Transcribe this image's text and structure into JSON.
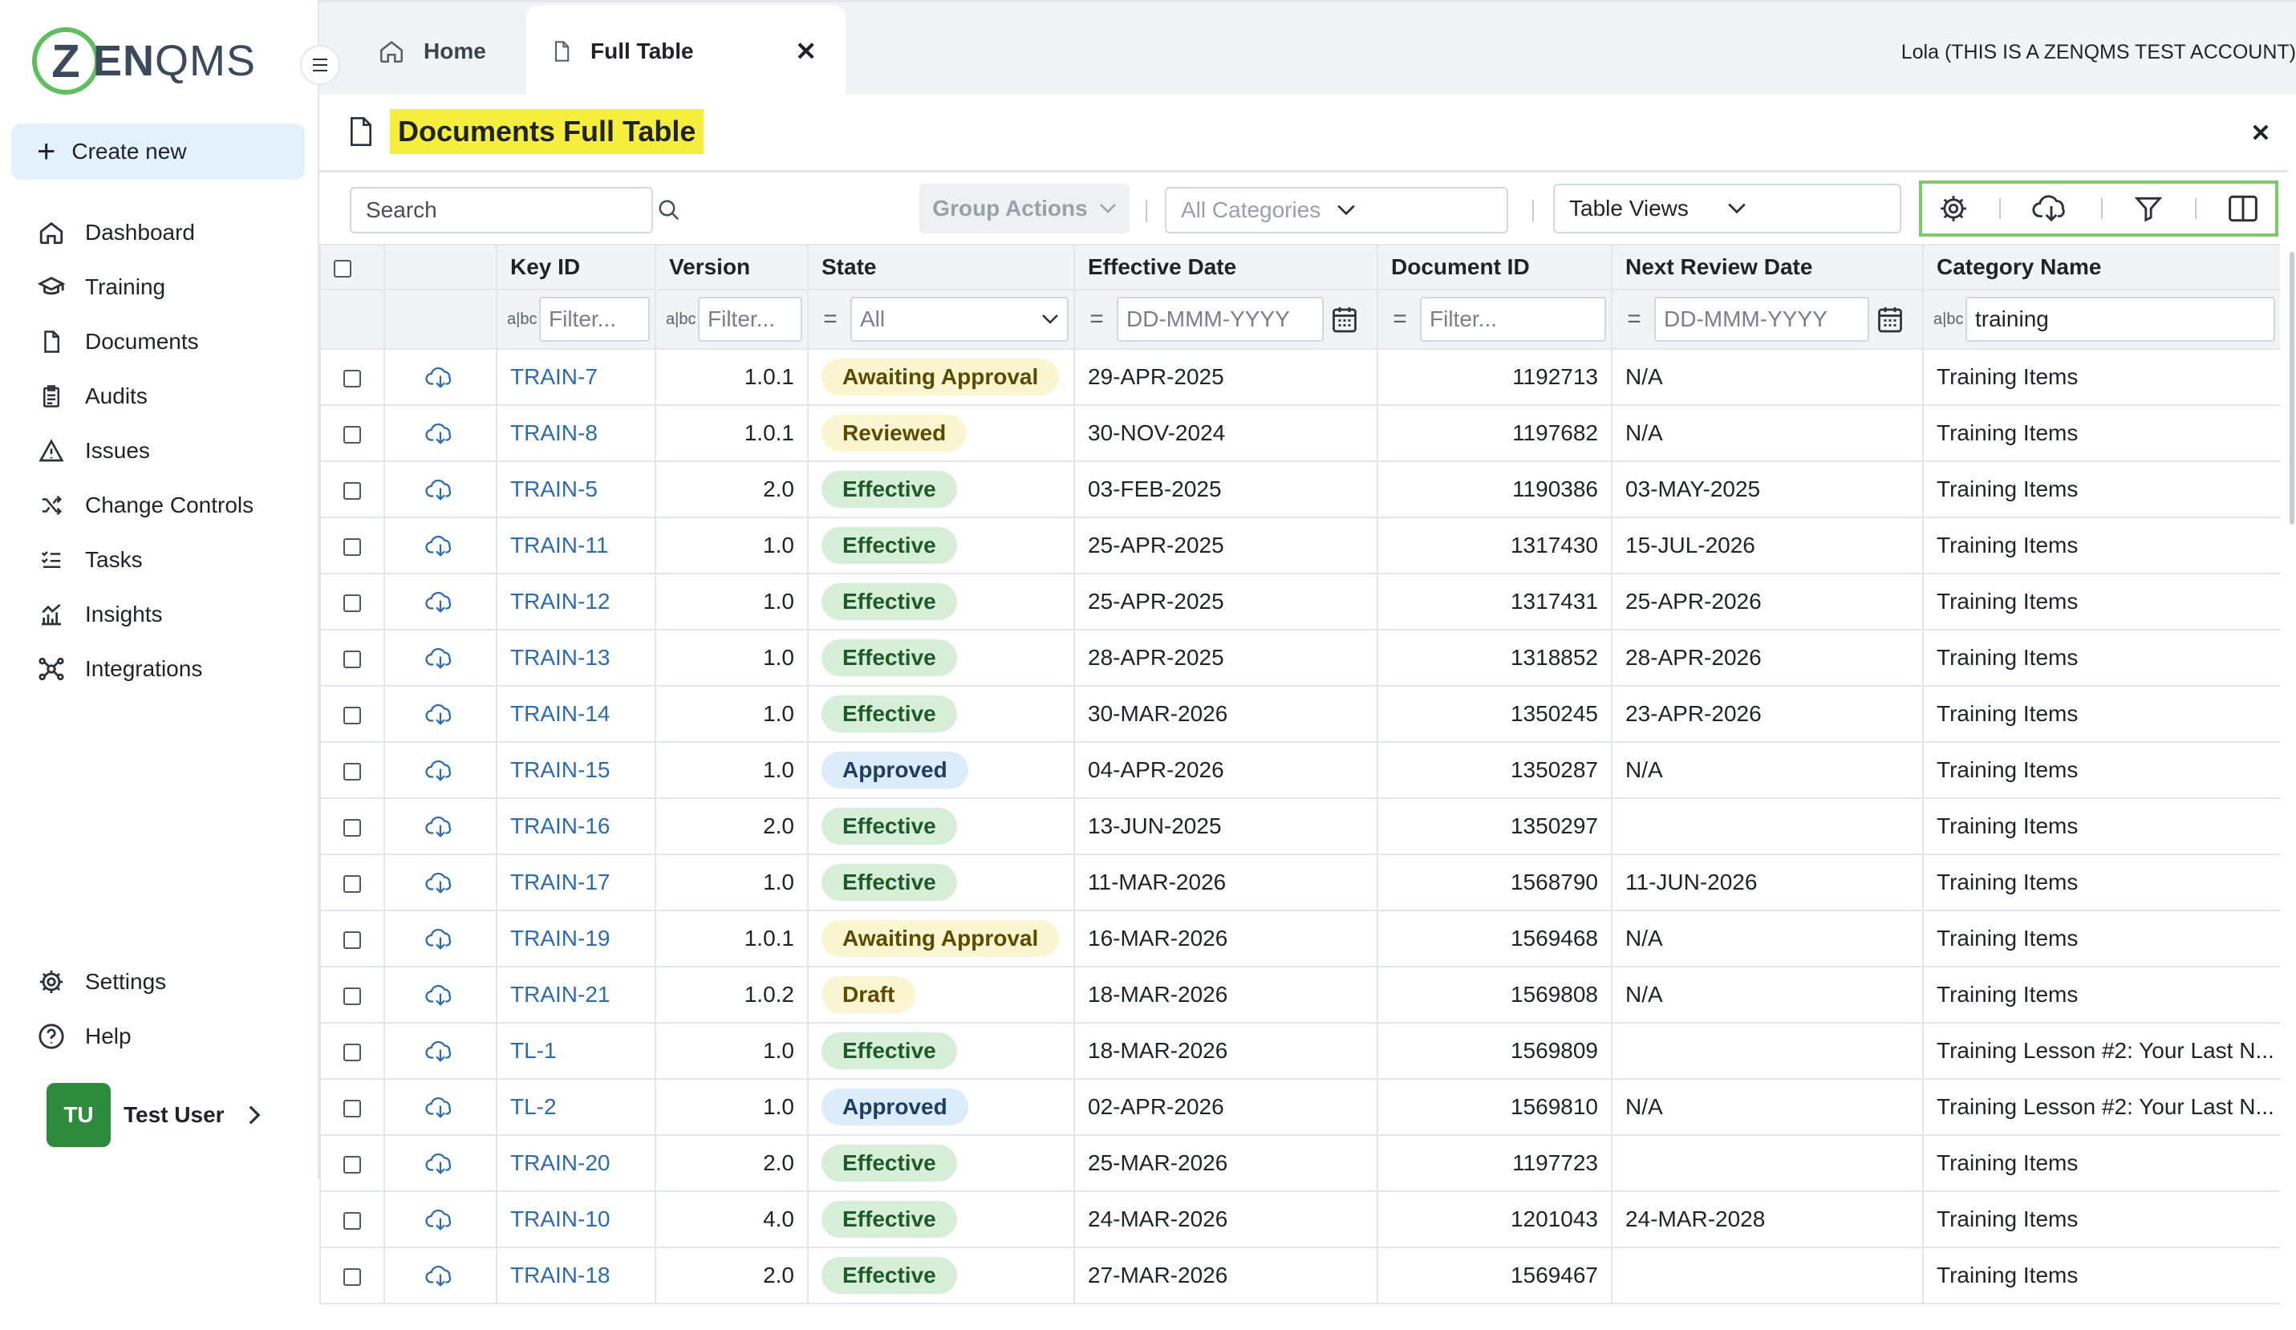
{
  "brand": {
    "logo_initial": "Z",
    "logo_bold": "EN",
    "logo_thin": "QMS"
  },
  "sidebar": {
    "create_new": "Create new",
    "items": [
      {
        "label": "Dashboard",
        "icon": "home-icon"
      },
      {
        "label": "Training",
        "icon": "graduation-cap-icon"
      },
      {
        "label": "Documents",
        "icon": "document-icon"
      },
      {
        "label": "Audits",
        "icon": "clipboard-icon"
      },
      {
        "label": "Issues",
        "icon": "warning-icon"
      },
      {
        "label": "Change Controls",
        "icon": "shuffle-icon"
      },
      {
        "label": "Tasks",
        "icon": "checklist-icon"
      },
      {
        "label": "Insights",
        "icon": "bar-chart-icon"
      },
      {
        "label": "Integrations",
        "icon": "network-icon"
      }
    ],
    "bottom_items": [
      {
        "label": "Settings",
        "icon": "gear-icon"
      },
      {
        "label": "Help",
        "icon": "help-icon"
      }
    ],
    "user": {
      "initials": "TU",
      "name": "Test User"
    }
  },
  "tabs": {
    "home": "Home",
    "full_table": "Full Table"
  },
  "account": "Lola (THIS IS A ZENQMS TEST ACCOUNT)",
  "page": {
    "title": "Documents Full Table"
  },
  "toolbar": {
    "search_placeholder": "Search",
    "group_actions": "Group Actions",
    "categories_placeholder": "All Categories",
    "table_views": "Table Views"
  },
  "table": {
    "columns": [
      "Key ID",
      "Version",
      "State",
      "Effective Date",
      "Document ID",
      "Next Review Date",
      "Category Name"
    ],
    "filters": {
      "key_id": "Filter...",
      "version": "Filter...",
      "state": "All",
      "effective_date": "DD-MMM-YYYY",
      "document_id": "Filter...",
      "next_review": "DD-MMM-YYYY",
      "category": "training",
      "text_type_glyph": "a|bc",
      "equals_glyph": "="
    },
    "state_colors": {
      "Awaiting Approval": {
        "bg": "#fbf6d2",
        "fg": "#5c4a00"
      },
      "Reviewed": {
        "bg": "#fbf6d2",
        "fg": "#5c4a00"
      },
      "Draft": {
        "bg": "#fbf6d2",
        "fg": "#5c4a00"
      },
      "Effective": {
        "bg": "#d7efd9",
        "fg": "#1e5a2a"
      },
      "Approved": {
        "bg": "#dcecfb",
        "fg": "#1d3d66"
      }
    },
    "rows": [
      {
        "key": "TRAIN-7",
        "version": "1.0.1",
        "state": "Awaiting Approval",
        "effective": "29-APR-2025",
        "doc_id": "1192713",
        "next_review": "N/A",
        "category": "Training Items"
      },
      {
        "key": "TRAIN-8",
        "version": "1.0.1",
        "state": "Reviewed",
        "effective": "30-NOV-2024",
        "doc_id": "1197682",
        "next_review": "N/A",
        "category": "Training Items"
      },
      {
        "key": "TRAIN-5",
        "version": "2.0",
        "state": "Effective",
        "effective": "03-FEB-2025",
        "doc_id": "1190386",
        "next_review": "03-MAY-2025",
        "category": "Training Items"
      },
      {
        "key": "TRAIN-11",
        "version": "1.0",
        "state": "Effective",
        "effective": "25-APR-2025",
        "doc_id": "1317430",
        "next_review": "15-JUL-2026",
        "category": "Training Items"
      },
      {
        "key": "TRAIN-12",
        "version": "1.0",
        "state": "Effective",
        "effective": "25-APR-2025",
        "doc_id": "1317431",
        "next_review": "25-APR-2026",
        "category": "Training Items"
      },
      {
        "key": "TRAIN-13",
        "version": "1.0",
        "state": "Effective",
        "effective": "28-APR-2025",
        "doc_id": "1318852",
        "next_review": "28-APR-2026",
        "category": "Training Items"
      },
      {
        "key": "TRAIN-14",
        "version": "1.0",
        "state": "Effective",
        "effective": "30-MAR-2026",
        "doc_id": "1350245",
        "next_review": "23-APR-2026",
        "category": "Training Items"
      },
      {
        "key": "TRAIN-15",
        "version": "1.0",
        "state": "Approved",
        "effective": "04-APR-2026",
        "doc_id": "1350287",
        "next_review": "N/A",
        "category": "Training Items"
      },
      {
        "key": "TRAIN-16",
        "version": "2.0",
        "state": "Effective",
        "effective": "13-JUN-2025",
        "doc_id": "1350297",
        "next_review": "",
        "category": "Training Items"
      },
      {
        "key": "TRAIN-17",
        "version": "1.0",
        "state": "Effective",
        "effective": "11-MAR-2026",
        "doc_id": "1568790",
        "next_review": "11-JUN-2026",
        "category": "Training Items"
      },
      {
        "key": "TRAIN-19",
        "version": "1.0.1",
        "state": "Awaiting Approval",
        "effective": "16-MAR-2026",
        "doc_id": "1569468",
        "next_review": "N/A",
        "category": "Training Items"
      },
      {
        "key": "TRAIN-21",
        "version": "1.0.2",
        "state": "Draft",
        "effective": "18-MAR-2026",
        "doc_id": "1569808",
        "next_review": "N/A",
        "category": "Training Items"
      },
      {
        "key": "TL-1",
        "version": "1.0",
        "state": "Effective",
        "effective": "18-MAR-2026",
        "doc_id": "1569809",
        "next_review": "",
        "category": "Training Lesson #2: Your Last N..."
      },
      {
        "key": "TL-2",
        "version": "1.0",
        "state": "Approved",
        "effective": "02-APR-2026",
        "doc_id": "1569810",
        "next_review": "N/A",
        "category": "Training Lesson #2: Your Last N..."
      },
      {
        "key": "TRAIN-20",
        "version": "2.0",
        "state": "Effective",
        "effective": "25-MAR-2026",
        "doc_id": "1197723",
        "next_review": "",
        "category": "Training Items"
      },
      {
        "key": "TRAIN-10",
        "version": "4.0",
        "state": "Effective",
        "effective": "24-MAR-2026",
        "doc_id": "1201043",
        "next_review": "24-MAR-2028",
        "category": "Training Items"
      },
      {
        "key": "TRAIN-18",
        "version": "2.0",
        "state": "Effective",
        "effective": "27-MAR-2026",
        "doc_id": "1569467",
        "next_review": "",
        "category": "Training Items"
      }
    ]
  }
}
